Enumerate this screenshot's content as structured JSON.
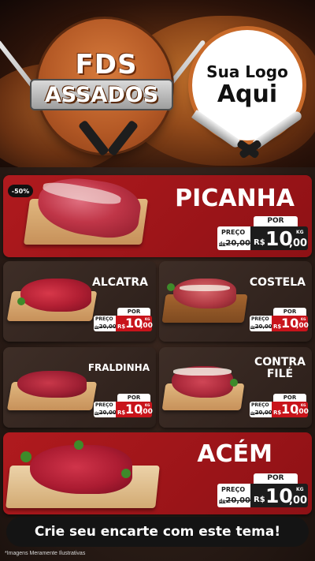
{
  "header": {
    "title_line1": "FDS",
    "title_line2": "ASSADOS",
    "logo_line1": "Sua Logo",
    "logo_line2": "Aqui"
  },
  "featured_top": {
    "badge": "-50%",
    "name": "PICANHA",
    "por_label": "POR",
    "preco_label": "PREÇO",
    "old_prefix": "de",
    "old_price": "20,00",
    "currency": "R$",
    "price_int": "10",
    "price_dec": ",00",
    "unit": "KG"
  },
  "products": [
    {
      "name": "ALCATRA",
      "por_label": "POR",
      "preco_label": "PREÇO",
      "old_prefix": "de",
      "old_price": "20,00",
      "currency": "R$",
      "price_int": "10",
      "price_dec": ",00",
      "unit": "KG"
    },
    {
      "name": "COSTELA",
      "por_label": "POR",
      "preco_label": "PREÇO",
      "old_prefix": "de",
      "old_price": "20,00",
      "currency": "R$",
      "price_int": "10",
      "price_dec": ",00",
      "unit": "KG"
    },
    {
      "name": "FRALDINHA",
      "por_label": "POR",
      "preco_label": "PREÇO",
      "old_prefix": "de",
      "old_price": "20,00",
      "currency": "R$",
      "price_int": "10",
      "price_dec": ",00",
      "unit": "KG"
    },
    {
      "name_line1": "CONTRA",
      "name_line2": "FILÉ",
      "por_label": "POR",
      "preco_label": "PREÇO",
      "old_prefix": "de",
      "old_price": "20,00",
      "currency": "R$",
      "price_int": "10",
      "price_dec": ",00",
      "unit": "KG"
    }
  ],
  "featured_bottom": {
    "name": "ACÉM",
    "por_label": "POR",
    "preco_label": "PREÇO",
    "old_prefix": "de",
    "old_price": "20,00",
    "currency": "R$",
    "price_int": "10",
    "price_dec": ",00",
    "unit": "KG"
  },
  "banner": "Crie seu encarte com este tema!",
  "disclaimer": "*Imagens Meramente Ilustrativas",
  "colors": {
    "accent_red": "#b01a1e",
    "dark_card": "#3e2e27",
    "tag_red": "#c8141b"
  }
}
